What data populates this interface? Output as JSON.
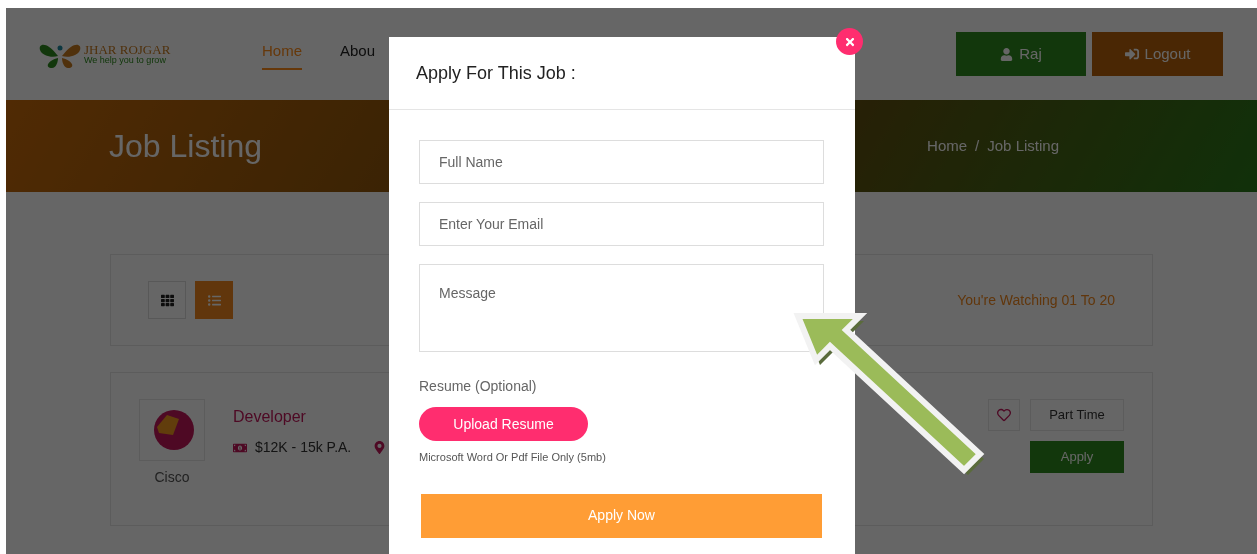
{
  "header": {
    "logo_text": "JHAR ROJGAR",
    "logo_tagline": "We help you to grow",
    "nav": [
      {
        "label": "Home",
        "selected": true
      },
      {
        "label": "Abou",
        "selected": false
      }
    ],
    "user_button": "Raj",
    "logout_button": "Logout"
  },
  "banner": {
    "title": "Job Listing",
    "breadcrumb": [
      "Home",
      "Job Listing"
    ],
    "separator": "/"
  },
  "toolbar": {
    "views": [
      {
        "kind": "grid",
        "selected": false
      },
      {
        "kind": "list",
        "selected": true
      }
    ],
    "count_text": "You're Watching 01 To 20"
  },
  "job": {
    "company": "Cisco",
    "title": "Developer",
    "salary": "$12K - 15k P.A.",
    "type": "Part Time",
    "apply": "Apply",
    "favorite": false
  },
  "modal": {
    "title": "Apply For This Job :",
    "fields": [
      {
        "kind": "input",
        "placeholder": "Full Name"
      },
      {
        "kind": "input",
        "placeholder": "Enter Your Email"
      },
      {
        "kind": "textarea",
        "placeholder": "Message"
      }
    ],
    "resume_label": "Resume (Optional)",
    "upload_button": "Upload Resume",
    "hint": "Microsoft Word Or Pdf File Only (5mb)",
    "submit": "Apply Now"
  }
}
